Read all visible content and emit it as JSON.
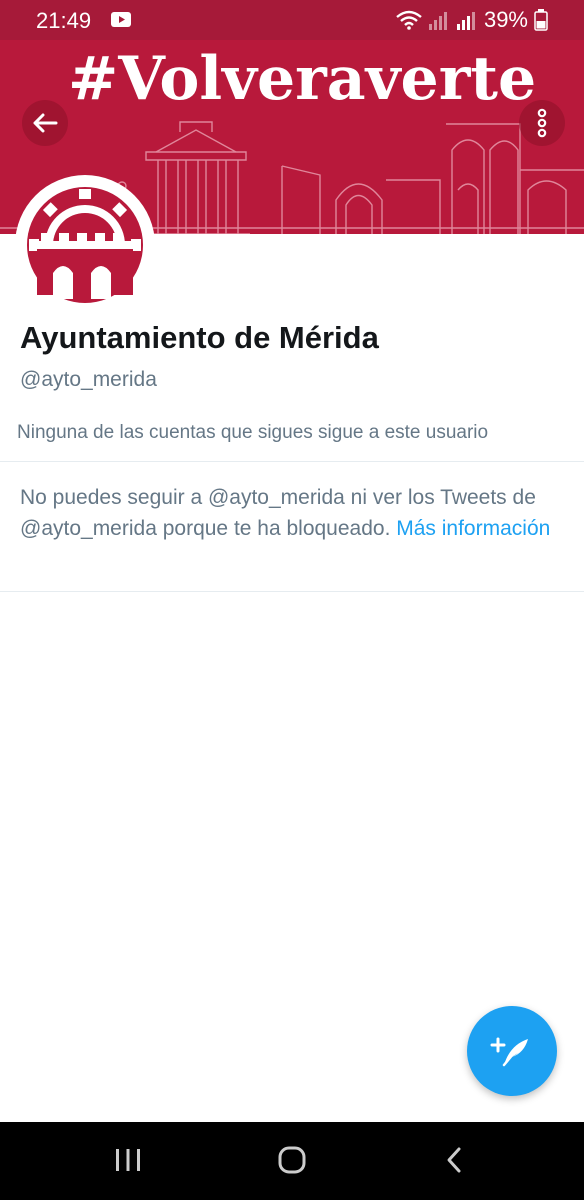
{
  "status_bar": {
    "time": "21:49",
    "battery": "39%",
    "icons": [
      "youtube-icon",
      "wifi-icon",
      "signal-icon",
      "battery-icon"
    ]
  },
  "banner": {
    "hashtag": "#Volveraverte",
    "bg_color": "#b8193b"
  },
  "profile": {
    "name": "Ayuntamiento de Mérida",
    "handle": "@ayto_merida",
    "followers_note": "Ninguna de las cuentas que sigues sigue a este usuario"
  },
  "blocked": {
    "message": "No puedes seguir a @ayto_merida ni ver los Tweets de @ayto_merida porque te ha bloqueado. ",
    "link": "Más información"
  },
  "colors": {
    "accent": "#1da1f2",
    "brand_red": "#a61a39",
    "secondary_text": "#657786"
  },
  "fab": {
    "icon": "compose-tweet-icon"
  },
  "nav_bar": {
    "buttons": [
      "recents-icon",
      "home-icon",
      "back-icon"
    ]
  }
}
